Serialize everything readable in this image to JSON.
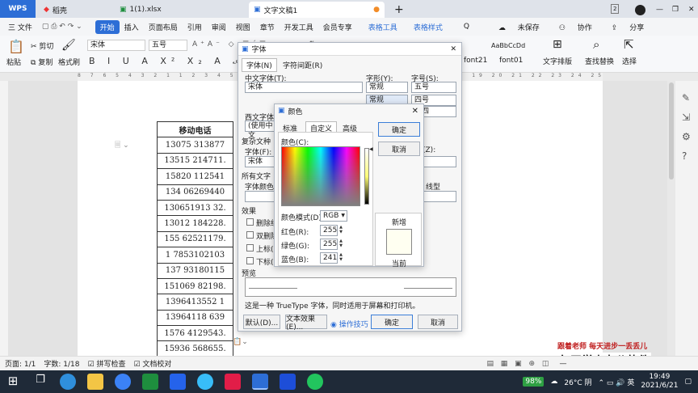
{
  "tabs": {
    "wps": "WPS",
    "t1": "稻壳",
    "t2": "1(1).xlsx",
    "t3": "文字文稿1",
    "plus": "+",
    "badge": "2"
  },
  "menu": {
    "file": "三 文件",
    "start": "开始",
    "insert": "插入",
    "layout": "页面布局",
    "ref": "引用",
    "review": "审阅",
    "view": "视图",
    "chapter": "章节",
    "dev": "开发工具",
    "member": "会员专享",
    "table_tool": "表格工具",
    "table_style": "表格样式",
    "search": "Q",
    "unsaved": "未保存",
    "collab": "协作",
    "share": "分享"
  },
  "ribbon": {
    "paste": "粘贴",
    "cut": "剪切",
    "copy": "复制",
    "format_painter": "格式刷",
    "font_name": "宋体",
    "font_size": "五号",
    "style_sample": "AaBbCcDd",
    "style1": "font21",
    "style2": "font01",
    "text_layout": "文字排版",
    "find_replace": "查找替换",
    "select": "选择"
  },
  "ruler_text": "8 7 6 5 4 3 2 1 1 2 3 4 5 6 7 8 9 10 11 12 13 14 15 16 17 18 19 20 21 22 23 24 25 26 27 28 29 30",
  "table": {
    "header": "移动电话",
    "rows": [
      "13075 313877",
      "13515 214711.",
      "15820 112541",
      "134 06269440",
      "130651913 32.",
      "13012 184228.",
      "155 62521179.",
      "1 7853102103",
      "137 93180115",
      "151069 82198.",
      "1396413552 1",
      "13964118 639",
      "1576 4129543.",
      "15936 568655."
    ]
  },
  "font_dialog": {
    "title": "字体",
    "tab_font": "字体(N)",
    "tab_spacing": "字符间距(R)",
    "cn_font_label": "中文字体(T):",
    "cn_font_value": "宋体",
    "style_label": "字形(Y):",
    "style_value": "常规",
    "style_list": [
      "常规"
    ],
    "size_label": "字号(S):",
    "size_value": "五号",
    "size_list": [
      "四号",
      "小四"
    ],
    "west_font_label": "西文字体(X",
    "west_font_value": "(使用中文",
    "complex_label": "复杂文种",
    "complex_font_label": "字体(F):",
    "complex_font_value": "宋体",
    "complex_size_label": "(Z):",
    "all_text_label": "所有文字",
    "color_label": "字体颜色(C",
    "underline_label": "线型",
    "effects_label": "效果",
    "eff1": "删除线",
    "eff2": "双删除",
    "eff3": "上标(P",
    "eff4": "下标(B",
    "preview_label": "预览",
    "truetype_note": "这是一种 TrueType 字体，同时适用于屏幕和打印机。",
    "default_btn": "默认(D)...",
    "effects_btn": "文本效果(E)...",
    "tips_link": "操作技巧",
    "ok_btn": "确定",
    "cancel_btn": "取消"
  },
  "color_dialog": {
    "title": "颜色",
    "tab_std": "标准",
    "tab_custom": "自定义",
    "tab_adv": "高级",
    "colors_label": "颜色(C):",
    "mode_label": "颜色模式(D)",
    "mode_value": "RGB",
    "red_label": "红色(R):",
    "red": "255",
    "green_label": "绿色(G):",
    "green": "255",
    "blue_label": "蓝色(B):",
    "blue": "241",
    "ok": "确定",
    "cancel": "取消",
    "new_label": "新增",
    "current_label": "当前",
    "new_color": "#fffff1"
  },
  "status": {
    "page": "页面: 1/1",
    "words": "字数: 1/18",
    "spell": "拼写检查",
    "proof": "文档校对",
    "zoom_minus": "—",
    "zoom_plus": "+"
  },
  "watermark": {
    "line1": "跟着老师  每天进步一丢丢儿",
    "line2": "每天学点办公软件"
  },
  "taskbar": {
    "battery": "98%",
    "weather": "26°C 阴",
    "time": "19:49",
    "date": "2021/6/21"
  }
}
